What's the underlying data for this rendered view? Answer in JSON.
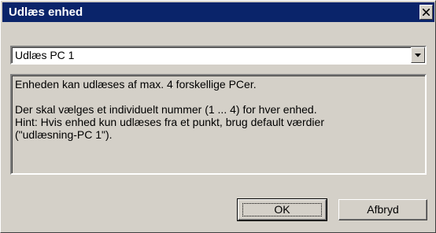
{
  "window": {
    "title": "Udlæs enhed",
    "close_icon": "close-icon"
  },
  "select": {
    "value": "Udlæs PC 1",
    "dropdown_icon": "chevron-down-icon"
  },
  "info": {
    "line1": "Enheden kan udlæses af max. 4 forskellige PCer.",
    "line2": "Der skal vælges et individuelt nummer (1 ... 4) for hver enhed.",
    "line3": "Hint: Hvis enhed kun udlæses fra et punkt, brug default værdier",
    "line4": "(\"udlæsning-PC 1\")."
  },
  "buttons": {
    "ok": "OK",
    "cancel": "Afbryd"
  },
  "colors": {
    "titlebar": "#0a246a",
    "face": "#d4d0c8"
  }
}
